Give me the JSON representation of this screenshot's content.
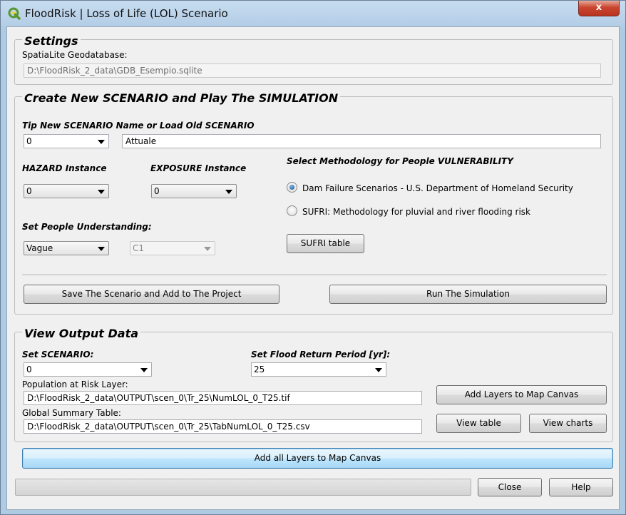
{
  "window": {
    "title": "FloodRisk | Loss of Life (LOL) Scenario",
    "close_glyph": "x"
  },
  "settings": {
    "title": "Settings",
    "geodb_label": "SpatiaLite Geodatabase:",
    "geodb_value": "D:\\FloodRisk_2_data\\GDB_Esempio.sqlite"
  },
  "scenario": {
    "title": "Create New SCENARIO and Play The SIMULATION",
    "name_label": "Tip New SCENARIO Name or Load Old SCENARIO",
    "combo_value": "0",
    "name_value": "Attuale",
    "hazard_label": "HAZARD Instance",
    "hazard_value": "0",
    "exposure_label": "EXPOSURE Instance",
    "exposure_value": "0",
    "method_label": "Select Methodology for People VULNERABILITY",
    "method_options": [
      "Dam Failure Scenarios - U.S. Department of Homeland Security",
      "SUFRI: Methodology for pluvial and river flooding risk"
    ],
    "selected_method": 0,
    "understanding_label": "Set People Understanding:",
    "understanding_value": "Vague",
    "c1_value": "C1",
    "sufri_button": "SUFRI table",
    "save_button": "Save The Scenario and Add to The Project",
    "run_button": "Run The Simulation"
  },
  "output": {
    "title": "View Output Data",
    "scenario_label": "Set SCENARIO:",
    "scenario_value": "0",
    "period_label": "Set Flood Return Period [yr]:",
    "period_value": "25",
    "population_label": "Population at Risk Layer:",
    "population_value": "D:\\FloodRisk_2_data\\OUTPUT\\scen_0\\Tr_25\\NumLOL_0_T25.tif",
    "summary_label": "Global Summary Table:",
    "summary_value": "D:\\FloodRisk_2_data\\OUTPUT\\scen_0\\Tr_25\\TabNumLOL_0_T25.csv",
    "add_layers_button": "Add Layers to Map Canvas",
    "view_table_button": "View table",
    "view_charts_button": "View charts"
  },
  "footer": {
    "add_all_button": "Add all Layers to Map Canvas",
    "progress": 0,
    "close_button": "Close",
    "help_button": "Help"
  },
  "colors": {
    "titlebar": "#b9d1ea",
    "close_button": "#c9452f",
    "qgis_green": "#589632",
    "qgis_yellow": "#f0d23c"
  },
  "icons": {
    "app": "qgis-logo-icon",
    "close": "close-icon",
    "dropdown": "chevron-down-icon"
  }
}
